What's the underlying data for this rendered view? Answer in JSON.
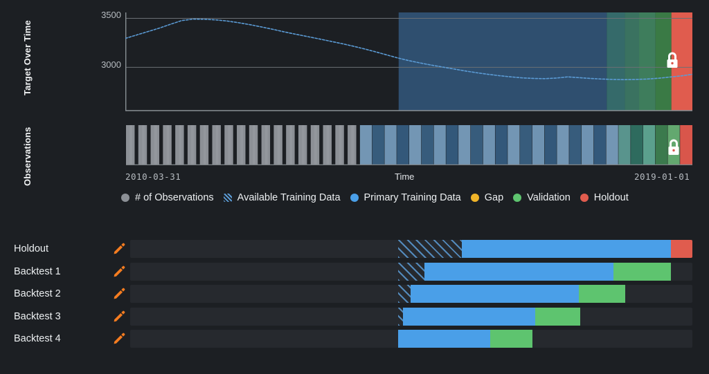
{
  "panels": {
    "target_label": "Target Over Time",
    "observations_label": "Observations"
  },
  "axis": {
    "y_ticks": [
      "3500",
      "3000"
    ],
    "x_start": "2010-03-31",
    "x_end": "2019-01-01",
    "x_title": "Time"
  },
  "legend": [
    {
      "label": "# of Observations",
      "color": "#8c9096",
      "style": "dot",
      "name": "legend-observations"
    },
    {
      "label": "Available Training Data",
      "color": "#5b9bd5",
      "style": "hatch",
      "name": "legend-available-training-data"
    },
    {
      "label": "Primary Training Data",
      "color": "#4a9fe8",
      "style": "dot",
      "name": "legend-primary-training-data"
    },
    {
      "label": "Gap",
      "color": "#f0b429",
      "style": "dot",
      "name": "legend-gap"
    },
    {
      "label": "Validation",
      "color": "#5ec46f",
      "style": "dot",
      "name": "legend-validation"
    },
    {
      "label": "Holdout",
      "color": "#e05c4e",
      "style": "dot",
      "name": "legend-holdout"
    }
  ],
  "colors": {
    "background": "#1c1f23",
    "panel": "#26292e",
    "line": "#5b9bd5",
    "observations_bar": "#8c9096",
    "primary_training": "#2f4f6f",
    "primary_training_bar": "#4a9fe8",
    "validation": "#5ec46f",
    "holdout": "#e05c4e",
    "accent_edit": "#f47c20",
    "gridline": "#6b7075",
    "lock": "#ffffff"
  },
  "locks": [
    {
      "name": "lock-icon-target",
      "panel": "target"
    },
    {
      "name": "lock-icon-observations",
      "panel": "observations"
    }
  ],
  "rows": [
    {
      "label": "Holdout",
      "name": "row-holdout",
      "available_start_pct": 47.7,
      "primary_start_pct": 59.0,
      "primary_end_pct": 96.2,
      "validation_end_pct": 96.2,
      "holdout_end_pct": 100.0,
      "has_holdout": true
    },
    {
      "label": "Backtest 1",
      "name": "row-backtest-1",
      "available_start_pct": 47.7,
      "primary_start_pct": 52.3,
      "primary_end_pct": 86.0,
      "validation_end_pct": 96.2,
      "holdout_end_pct": 96.2,
      "has_holdout": false
    },
    {
      "label": "Backtest 2",
      "name": "row-backtest-2",
      "available_start_pct": 47.7,
      "primary_start_pct": 49.9,
      "primary_end_pct": 79.8,
      "validation_end_pct": 88.0,
      "holdout_end_pct": 88.0,
      "has_holdout": false
    },
    {
      "label": "Backtest 3",
      "name": "row-backtest-3",
      "available_start_pct": 47.7,
      "primary_start_pct": 48.5,
      "primary_end_pct": 72.0,
      "validation_end_pct": 80.0,
      "holdout_end_pct": 80.0,
      "has_holdout": false
    },
    {
      "label": "Backtest 4",
      "name": "row-backtest-4",
      "available_start_pct": 47.7,
      "primary_start_pct": 47.7,
      "primary_end_pct": 64.0,
      "validation_end_pct": 71.5,
      "holdout_end_pct": 71.5,
      "has_holdout": false
    }
  ],
  "chart_data": {
    "type": "line",
    "title": "Target Over Time",
    "xlabel": "Time",
    "ylabel": "",
    "ylim": [
      2600,
      3560
    ],
    "xlim": [
      "2010-03-31",
      "2019-01-01"
    ],
    "ytick_values": [
      3500,
      3000
    ],
    "grid": true,
    "series": [
      {
        "name": "Target",
        "color": "#5b9bd5",
        "x_pct": [
          0,
          2,
          4,
          6,
          8,
          10,
          12,
          14,
          16,
          18,
          20,
          22,
          24,
          26,
          28,
          30,
          32,
          34,
          36,
          38,
          40,
          42,
          44,
          46,
          48,
          50,
          52,
          54,
          56,
          58,
          60,
          62,
          64,
          66,
          68,
          70,
          72,
          74,
          76,
          78,
          80,
          82,
          84,
          86,
          88,
          90,
          92,
          94,
          96,
          98,
          100
        ],
        "values": [
          3295,
          3330,
          3365,
          3400,
          3440,
          3478,
          3492,
          3490,
          3484,
          3472,
          3455,
          3435,
          3412,
          3388,
          3362,
          3338,
          3315,
          3292,
          3268,
          3244,
          3218,
          3190,
          3160,
          3128,
          3096,
          3068,
          3044,
          3022,
          3002,
          2982,
          2962,
          2944,
          2928,
          2914,
          2902,
          2892,
          2886,
          2884,
          2890,
          2902,
          2894,
          2886,
          2880,
          2876,
          2874,
          2876,
          2880,
          2888,
          2900,
          2912,
          2928
        ]
      }
    ]
  },
  "target_regions": [
    {
      "name": "primary-training-region",
      "start_pct": 48.2,
      "end_pct": 84.9,
      "color": "#2f4f6f"
    },
    {
      "name": "validation-band-1",
      "start_pct": 84.9,
      "end_pct": 88.1,
      "color": "#356a6a"
    },
    {
      "name": "validation-band-2",
      "start_pct": 88.1,
      "end_pct": 90.6,
      "color": "#3a7260"
    },
    {
      "name": "validation-band-3",
      "start_pct": 90.6,
      "end_pct": 93.5,
      "color": "#3e7d5c"
    },
    {
      "name": "validation-band-4",
      "start_pct": 93.5,
      "end_pct": 96.3,
      "color": "#3a7a45"
    },
    {
      "name": "holdout-region",
      "start_pct": 96.3,
      "end_pct": 100.0,
      "color": "#e05c4e"
    }
  ],
  "observations_bars": {
    "count": 46,
    "gray_count": 19,
    "blue_count": 21,
    "green_count": 5,
    "red_count": 1,
    "gray_color": "#8c9096",
    "blue_colors": [
      "#7396b4",
      "#375c7c",
      "#6f93b2",
      "#33587a"
    ],
    "green_colors": [
      "#59948d",
      "#2e6b5e",
      "#5ba08d",
      "#3b7a4d",
      "#63a86f"
    ],
    "red_color": "#d9564b"
  }
}
